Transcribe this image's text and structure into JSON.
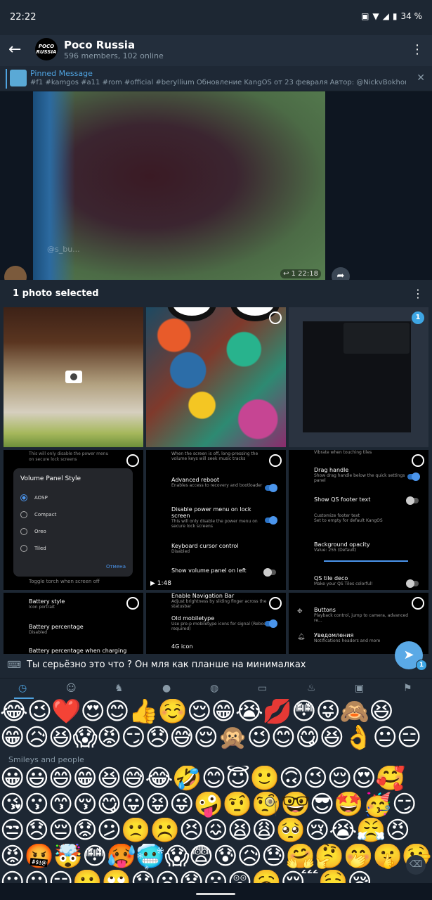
{
  "status": {
    "time": "22:22",
    "battery": "34 %"
  },
  "appbar": {
    "title": "Poco Russia",
    "subtitle": "596 members, 102 online",
    "avatar_line1": "POCO",
    "avatar_line2": "RUSSIA"
  },
  "pinned": {
    "title": "Pinned Message",
    "text": "#f1 #kamgos #a11 #rom #official #beryllium  Обновление KangOS от 23 февраля Автор: @NickvBokhorst..."
  },
  "photo": {
    "watermark": "@s_bu...",
    "meta": "↩ 1  22:18"
  },
  "sheet": {
    "header": "1 photo selected",
    "selected_badge": "1",
    "video_duration": "▶ 1:48",
    "volume_dialog": {
      "title": "Volume Panel Style",
      "options": [
        "AOSP",
        "Compact",
        "Oreo",
        "Tiled"
      ],
      "cancel": "Отмена",
      "top_line1": "This will only disable the power menu",
      "top_line2": "on secure lock screens",
      "bottom_line": "Toggle torch when screen off"
    },
    "settings_mid": [
      {
        "title": "When the screen is off, long-pressing the volume keys will seek music tracks",
        "sub": ""
      },
      {
        "title": "Advanced reboot",
        "sub": "Enables access to recovery and bootloader"
      },
      {
        "title": "Disable power menu on lock screen",
        "sub": "This will only disable the power menu on secure lock screens"
      },
      {
        "title": "Keyboard cursor control",
        "sub": "Disabled"
      },
      {
        "title": "Show volume panel on left",
        "sub": ""
      }
    ],
    "settings_right": [
      {
        "title": "Vibrate when touching tiles",
        "sub": ""
      },
      {
        "title": "Drag handle",
        "sub": "Show drag handle below the quick settings panel"
      },
      {
        "title": "Show QS footer text",
        "sub": ""
      },
      {
        "title": "Customize footer text",
        "sub": "Set to empty for default KangOS"
      },
      {
        "title": "Background opacity",
        "sub": "Value: 255 (Default)"
      },
      {
        "title": "QS tile deco",
        "sub": "Make your QS Tiles colorful!"
      }
    ],
    "settings_bl": [
      {
        "title": "Battery style",
        "sub": "Icon portrait"
      },
      {
        "title": "Battery percentage",
        "sub": "Disabled"
      },
      {
        "title": "Battery percentage when charging",
        "sub": ""
      }
    ],
    "settings_bm": [
      {
        "title": "Enable Navigation Bar",
        "sub": "Adjust brightness by sliding finger across the statusbar"
      },
      {
        "title": "Old mobiletype",
        "sub": "Use pre-p mobiletype icons for signal (Reboot required)"
      },
      {
        "title": "4G icon",
        "sub": ""
      }
    ],
    "settings_br": [
      {
        "title": "Buttons",
        "sub": "Playback control, jump to camera, advanced re..."
      },
      {
        "title": "Уведомления",
        "sub": "Notifications headers and more"
      }
    ]
  },
  "input": {
    "text": "Ты серьёзно это что ? Он мля как планше на минималках",
    "send_badge": "1"
  },
  "emoji": {
    "section_label": "Smileys and people",
    "row1": "😂😉❤️😍😊👍☺️😌😁😭💋😳😜🙈😆",
    "row2": "😁😥😆😱😡😏😞😅😌🙊😉😊😋😆👌😐😑",
    "row3": "😀😃😄😁😆😅😂🤣😊😇🙂🙃😉😌😍🥰",
    "row4": "😘😗😙😚😋😛😝😜🤪🤨🧐🤓😎🤩🥳😏",
    "row5": "😒😞😔😟😕🙁☹️😣😖😫😩🥺😢😭😤😠",
    "row6": "😡🤬🤯😳🥵🥶😱😨😰😥😓🤗🤔🤭🤫🤥",
    "row7": "😶😐😑😬🙄😯😦😧😮😲🥱😴🤤😪"
  }
}
